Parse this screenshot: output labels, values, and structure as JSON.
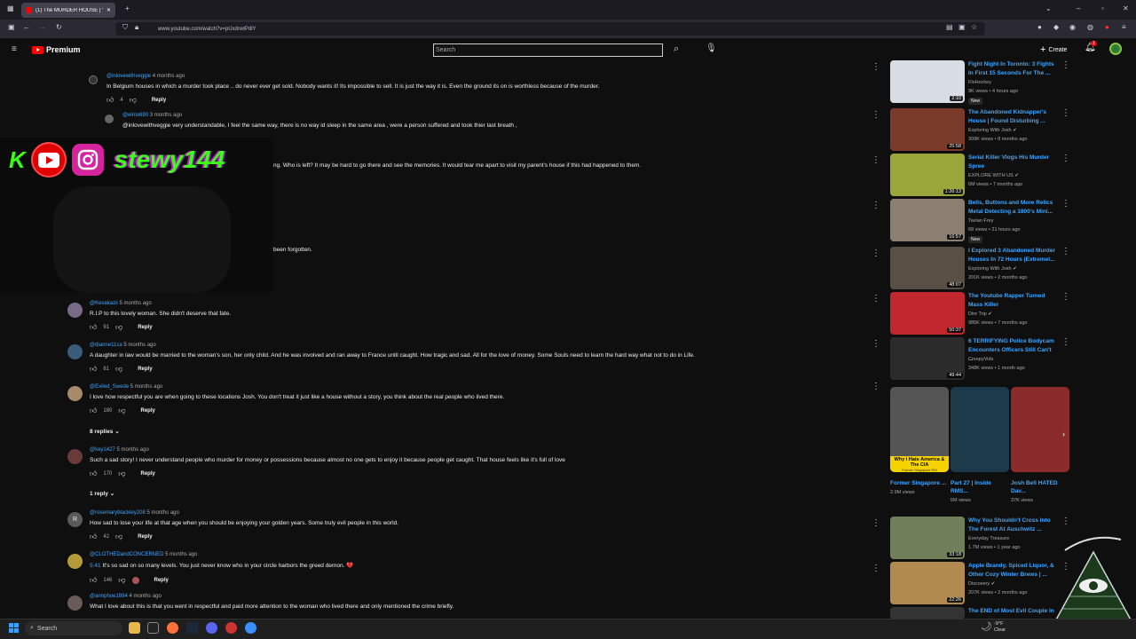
{
  "browser": {
    "tab_title": "(1) The MURDER HOUSE | Very",
    "url": "www.youtube.com/watch?v=pUxdrwtPdlY"
  },
  "masthead": {
    "brand": "Premium",
    "search_placeholder": "Search",
    "create_label": "Create",
    "notif_count": "1"
  },
  "comments": [
    {
      "author": "@inlovewithveggie",
      "time": "4 months ago",
      "text": "In Belgium houses in which a murder took place .. do never ever get sold. Nobody wants it! Its impossible to sell. It is just the way it is. Even the ground its on is worthless because of the murder.",
      "likes": "4",
      "reply": "Reply"
    },
    {
      "author": "@elmo690",
      "time": "3 months ago",
      "text": "@inlovewithveggie very understandable,  I feel the same way,  there is no way id sleep in the same area , were a person suffered and took thier last breath ,",
      "likes": "",
      "reply": ""
    },
    {
      "author": "",
      "time": "",
      "text": "ng. Who is left? It may be hard to go there and see the memories. It would tear me apart to visit my parent's house if this had happened to them.",
      "likes": "",
      "reply": ""
    },
    {
      "author": "",
      "time": "",
      "text": "been forgotten.",
      "likes": "",
      "reply": ""
    },
    {
      "author": "@Kevakazii",
      "time": "5 months ago",
      "text": "R.I.P to this lovely woman. She didn't deserve that fate.",
      "likes": "91",
      "reply": "Reply"
    },
    {
      "author": "@dianne11ca",
      "time": "5 months ago",
      "text": "A daughter in law would be married to the woman's son, her only child. And he was involved and ran away to France until caught. How tragic and sad. All for the love of money. Some Souls need to learn the hard way what not to do in Life.",
      "likes": "61",
      "reply": "Reply"
    },
    {
      "author": "@Exiled_Swede",
      "time": "5 months ago",
      "text": "I love how respectful you are when going to these locations Josh. You don't treat it just like a house without a story, you think about the real people who lived there.",
      "likes": "180",
      "reply": "Reply"
    },
    {
      "author": "@key1427",
      "time": "5 months ago",
      "text": "Such a sad story!  I never understand people who murder for money or possessions because almost no one gets to enjoy it because people get caught. That house feels like it's full of love",
      "likes": "170",
      "reply": "Reply"
    },
    {
      "author": "@rosemaryblackley208",
      "time": "5 months ago",
      "text": "How sad to lose your life at that age when you should be enjoying your golden years. Some truly evil people in this world.",
      "likes": "42",
      "reply": "Reply"
    },
    {
      "author": "@CLOTHEDandCONCERNED",
      "time": "5 months ago",
      "text": "It's so sad on so many levels. You just never know who in your circle harbors the greed demon. 💔",
      "timestamp": "5:41",
      "likes": "146",
      "reply": "Reply"
    },
    {
      "author": "@annphoe1994",
      "time": "4 months ago",
      "text": "What I love about this is that you went in respectful and paid more attention to the woman who lived there and only mentioned the crime briefly.",
      "likes": "",
      "reply": ""
    }
  ],
  "reply_toggles": [
    "8 replies",
    "1 reply"
  ],
  "overlay": {
    "handle": "stewy144",
    "k_letter": "K"
  },
  "sidebar": [
    {
      "title": "Fight Night In Toronto: 3 Fights In First 15 Seconds For The ...",
      "channel": "FloHockey",
      "meta": "9K views • 4 hours ago",
      "badge": "New",
      "duration": "2:10",
      "thumb": "#d8dde4"
    },
    {
      "title": "The Abandoned Kidnapper's House | Found Disturbing ...",
      "channel": "Exploring With Josh ✔",
      "meta": "309K views • 8 months ago",
      "badge": "",
      "duration": "25:58",
      "thumb": "#7a3b2a"
    },
    {
      "title": "Serial Killer Vlogs His Murder Spree",
      "channel": "EXPLORE WITH US ✔",
      "meta": "6M views • 7 months ago",
      "badge": "",
      "duration": "1:26:13",
      "thumb": "#9ba63a"
    },
    {
      "title": "Bells, Buttons and More Relics Metal Detecting a 1800's Mini...",
      "channel": "Tavian Frey",
      "meta": "68 views • 21 hours ago",
      "badge": "New",
      "duration": "16:57",
      "thumb": "#8b7f72"
    },
    {
      "title": "I Explored 3 Abandoned Murder Houses In 72 Hours (Extremel...",
      "channel": "Exploring With Josh ✔",
      "meta": "201K views • 2 months ago",
      "badge": "",
      "duration": "48:07",
      "thumb": "#5a4f44"
    },
    {
      "title": "The Youtube Rapper Turned Mass Killer",
      "channel": "Dire Trip ✔",
      "meta": "985K views • 7 months ago",
      "badge": "",
      "duration": "50:37",
      "thumb": "#c1272d"
    },
    {
      "title": "6 TERRIFYING Police Bodycam Encounters Officers Still Can't ...",
      "channel": "CreepyVids",
      "meta": "348K views • 1 month ago",
      "badge": "",
      "duration": "49:44",
      "thumb": "#2b2b2b"
    },
    {
      "title": "Why You Shouldn't Cross Into The Forest At Auschwitz ...",
      "channel": "Everyday Treasure",
      "meta": "1.7M views • 1 year ago",
      "badge": "",
      "duration": "33:18",
      "thumb": "#6e7f5a"
    },
    {
      "title": "Apple Brandy, Spiced Liquor, & Other Cozy Winter Brews | ...",
      "channel": "Discovery ✔",
      "meta": "207K views • 2 months ago",
      "badge": "",
      "duration": "22:26",
      "thumb": "#b08a4e"
    },
    {
      "title": "The END of Most Evil Couple In ...",
      "channel": "",
      "meta": "",
      "badge": "",
      "duration": "",
      "thumb": "#333333"
    }
  ],
  "shorts": [
    {
      "title": "Former Singapore ...",
      "views": "2.9M views",
      "caption": "Why I Hate America & The CIA",
      "sub": "Former Singapore PM",
      "thumb": "#555555"
    },
    {
      "title": "Part 27 | Inside RMS...",
      "views": "5M views",
      "thumb": "#1d3a4a"
    },
    {
      "title": "Josh Bell HATED Dav...",
      "views": "37K views",
      "thumb": "#8a2a2a"
    }
  ],
  "taskbar": {
    "search_label": "Search",
    "temp": "-9°F",
    "condition": "Clear"
  }
}
